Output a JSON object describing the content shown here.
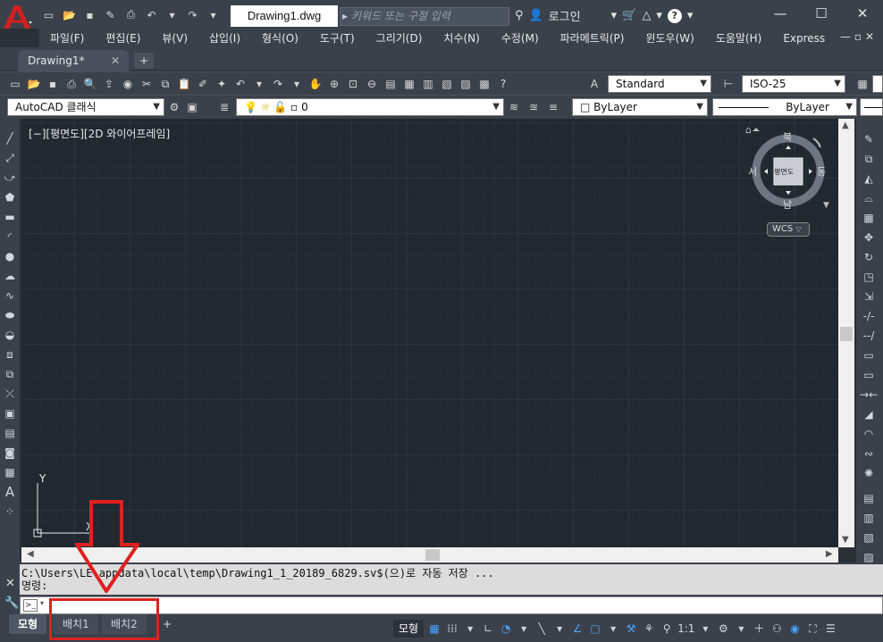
{
  "titlebar": {
    "document_title": "Drawing1.dwg",
    "search_placeholder": "키워드 또는 구절 입력",
    "login_label": "로그인",
    "help_label": "?",
    "window_controls": [
      "minimize",
      "maximize",
      "close"
    ]
  },
  "menubar": {
    "items": [
      "파일(F)",
      "편집(E)",
      "뷰(V)",
      "삽입(I)",
      "형식(O)",
      "도구(T)",
      "그리기(D)",
      "치수(N)",
      "수정(M)",
      "파라메트릭(P)",
      "윈도우(W)",
      "도움말(H)",
      "Express"
    ]
  },
  "tabs": {
    "active_doc": "Drawing1*",
    "new_tab": "+"
  },
  "toolbar1": {
    "text_style": "Standard",
    "dim_style": "ISO-25"
  },
  "toolbar2": {
    "workspace": "AutoCAD 클래식",
    "layer": "0",
    "color": "ByLayer",
    "linetype": "ByLayer"
  },
  "viewport": {
    "label": "[−][평면도][2D 와이어프레임]",
    "viewcube": {
      "north": "북",
      "south": "남",
      "east": "동",
      "west": "서",
      "face": "평면도"
    },
    "ucs_label": "WCS",
    "ucs_axis_y": "Y",
    "ucs_axis_x": "X"
  },
  "command": {
    "history_line1": "C:\\Users\\LE\\appdata\\local\\temp\\Drawing1_1_20189_6829.sv$(으)로 자동 저장 ...",
    "history_line2": "명령:"
  },
  "statusbar": {
    "layout_tabs": [
      "모형",
      "배치1",
      "배치2"
    ],
    "add_tab": "+",
    "model_label": "모형",
    "scale": "1:1"
  },
  "colors": {
    "chrome": "#3b414b",
    "canvas": "#212830",
    "annotation_red": "#e02020"
  }
}
